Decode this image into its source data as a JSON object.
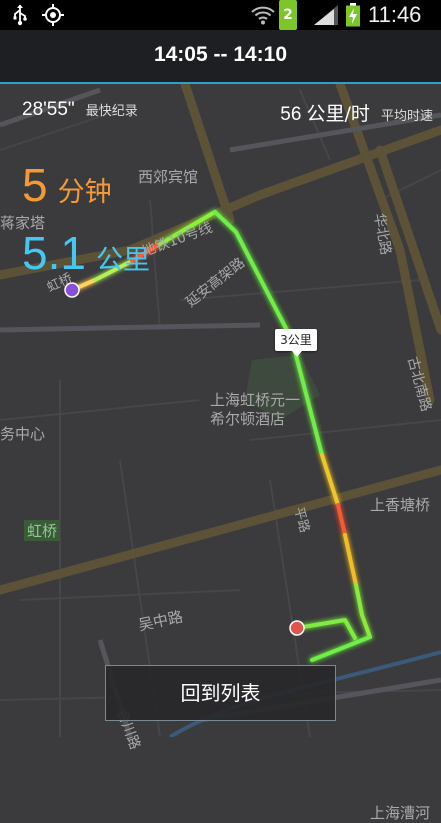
{
  "status_bar": {
    "time": "11:46",
    "notification_count": "2",
    "icons": [
      "usb-icon",
      "gps-icon",
      "wifi-icon",
      "signal-icon",
      "battery-charging-icon"
    ]
  },
  "header": {
    "title": "14:05 -- 14:10"
  },
  "stats": {
    "fastest_value": "28'55\"",
    "fastest_label": "最快纪录",
    "avg_speed_value": "56",
    "avg_speed_unit": "公里/时",
    "avg_speed_label": "平均时速",
    "duration_value": "5",
    "duration_unit": "分钟",
    "distance_value": "5.1",
    "distance_unit": "公里"
  },
  "map": {
    "labels": {
      "top_road": "西郊宾馆",
      "jiajiata": "蒋家塔",
      "metro": "地铁10号线",
      "elevated": "延安高架路",
      "hongqiao": "虹桥",
      "hotel_line1": "上海虹桥元一",
      "hotel_line2": "希尔顿酒店",
      "service_center": "务中心",
      "hongqiao_badge": "虹桥",
      "shangxiang": "上香塘桥",
      "wuzhong": "吴中路",
      "hechuan": "合川路",
      "caohe": "上海漕河",
      "huaxi": "华北路",
      "gubei": "古北南路",
      "road_vertical": "平路"
    },
    "km_marker": "3公里",
    "start_color": "#8a4fd8",
    "end_color": "#e0544e"
  },
  "footer": {
    "back_button_label": "回到列表"
  }
}
